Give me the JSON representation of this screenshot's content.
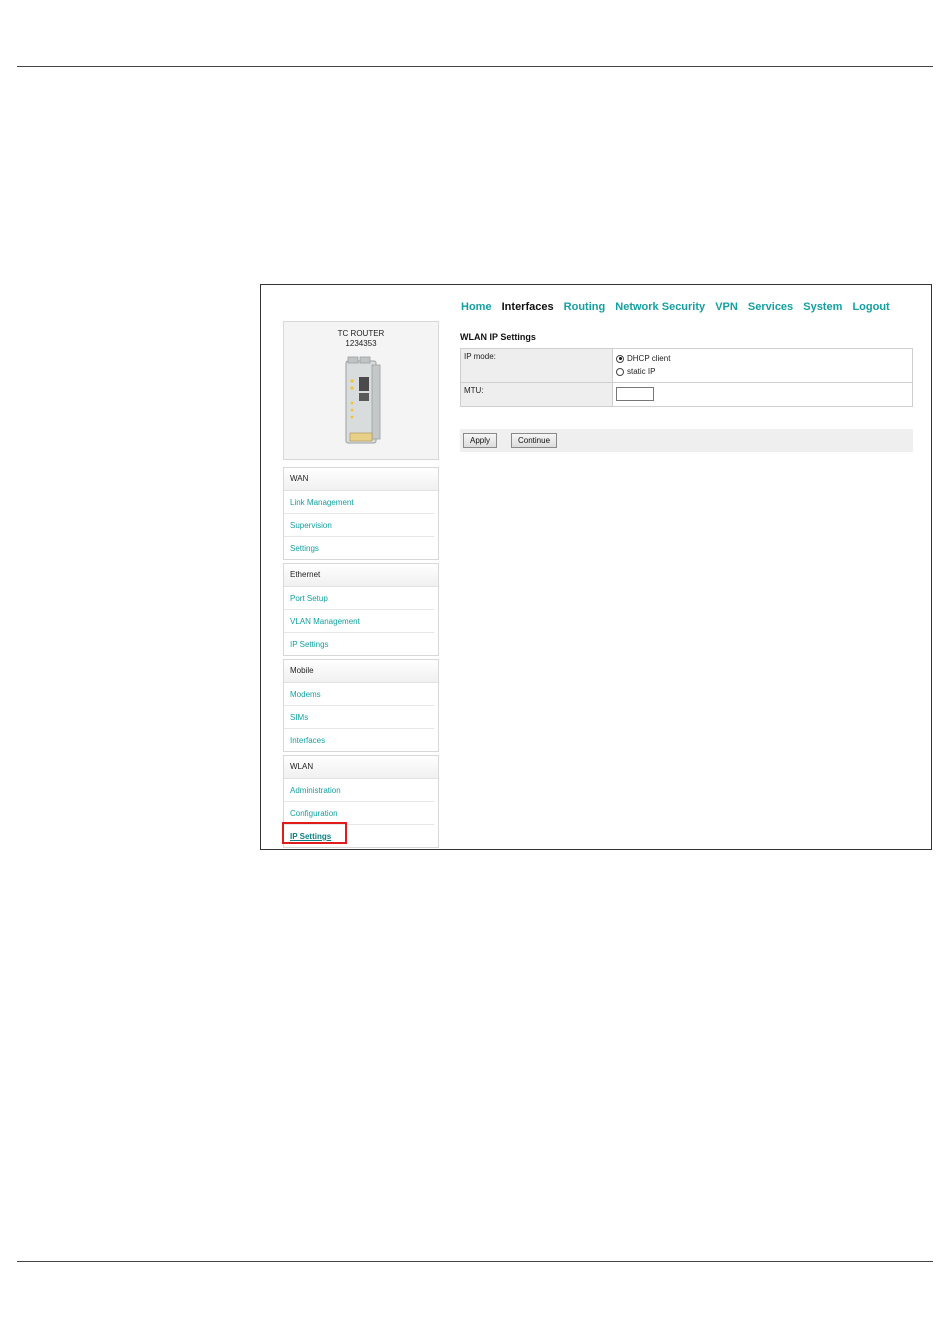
{
  "nav": {
    "items": [
      {
        "label": "Home",
        "active": false
      },
      {
        "label": "Interfaces",
        "active": true
      },
      {
        "label": "Routing",
        "active": false
      },
      {
        "label": "Network Security",
        "active": false
      },
      {
        "label": "VPN",
        "active": false
      },
      {
        "label": "Services",
        "active": false
      },
      {
        "label": "System",
        "active": false
      },
      {
        "label": "Logout",
        "active": false
      }
    ]
  },
  "device": {
    "name": "TC ROUTER",
    "number": "1234353"
  },
  "sidebar": {
    "groups": [
      {
        "title": "WAN",
        "items": [
          "Link Management",
          "Supervision",
          "Settings"
        ]
      },
      {
        "title": "Ethernet",
        "items": [
          "Port Setup",
          "VLAN Management",
          "IP Settings"
        ]
      },
      {
        "title": "Mobile",
        "items": [
          "Modems",
          "SIMs",
          "Interfaces"
        ]
      },
      {
        "title": "WLAN",
        "items": [
          "Administration",
          "Configuration",
          "IP Settings"
        ]
      }
    ],
    "current": "IP Settings"
  },
  "main": {
    "title": "WLAN IP Settings",
    "ip_mode_label": "IP mode:",
    "ip_mode_options": [
      "DHCP client",
      "static IP"
    ],
    "ip_mode_selected": "DHCP client",
    "mtu_label": "MTU:",
    "mtu_value": "",
    "apply_label": "Apply",
    "continue_label": "Continue"
  },
  "colors": {
    "link": "#14a0a0",
    "highlight_box": "#e01b1b"
  }
}
